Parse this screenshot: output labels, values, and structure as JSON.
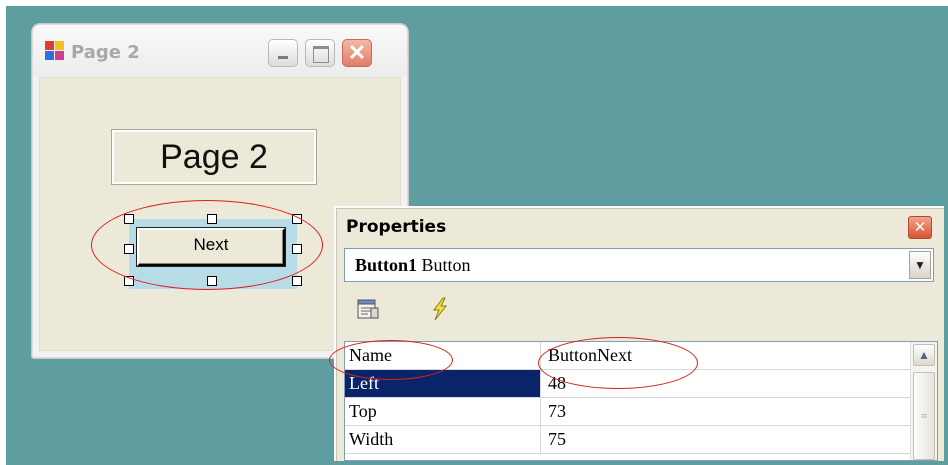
{
  "form_window": {
    "title": "Page 2",
    "minimize_label": "",
    "maximize_label": "",
    "close_label": "✕",
    "label_text": "Page 2",
    "button_text": "Next"
  },
  "properties": {
    "title": "Properties",
    "close_label": "✕",
    "object_name": "Button1",
    "object_type": " Button",
    "combo_arrow": "▼",
    "toolbar": {
      "categorized_icon": "properties-page-icon",
      "events_icon": "lightning-bolt-icon"
    },
    "rows": [
      {
        "name": "Name",
        "value": "ButtonNext"
      },
      {
        "name": "Left",
        "value": "48"
      },
      {
        "name": "Top",
        "value": "73"
      },
      {
        "name": "Width",
        "value": "75"
      }
    ],
    "selected_row": "Left",
    "scroll_up": "▲",
    "scroll_grip": "≡"
  },
  "colors": {
    "desktop": "#5f9ea0",
    "selection_highlight": "#0a246a",
    "annotation": "#d92020",
    "design_selection": "#b7dbe7"
  }
}
